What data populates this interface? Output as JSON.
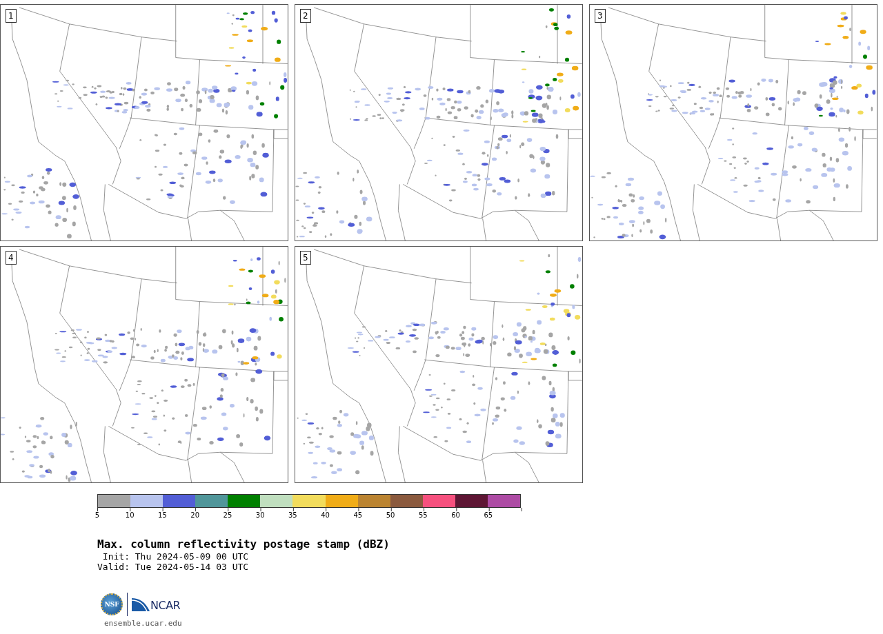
{
  "panels": [
    {
      "label": "1"
    },
    {
      "label": "2"
    },
    {
      "label": "3"
    },
    {
      "label": "4"
    },
    {
      "label": "5"
    }
  ],
  "colorbar": {
    "segments": [
      {
        "color": "#a5a5a5"
      },
      {
        "color": "#b8c4ee"
      },
      {
        "color": "#525ed6"
      },
      {
        "color": "#50969a"
      },
      {
        "color": "#008000"
      },
      {
        "color": "#c0dfbf"
      },
      {
        "color": "#f2dc5c"
      },
      {
        "color": "#f0ac17"
      },
      {
        "color": "#bb8431"
      },
      {
        "color": "#8b5a3e"
      },
      {
        "color": "#f6507e"
      },
      {
        "color": "#5e1634"
      },
      {
        "color": "#ad4ba4"
      }
    ],
    "ticks": [
      "5",
      "10",
      "15",
      "20",
      "25",
      "30",
      "35",
      "40",
      "45",
      "50",
      "55",
      "60",
      "65"
    ]
  },
  "title": "Max. column reflectivity postage stamp (dBZ)",
  "init": " Init: Thu 2024-05-09 00 UTC",
  "valid": "Valid: Tue 2024-05-14 03 UTC",
  "logo": {
    "nsf": "NSF",
    "ncar": "NCAR"
  },
  "url": "ensemble.ucar.edu"
}
